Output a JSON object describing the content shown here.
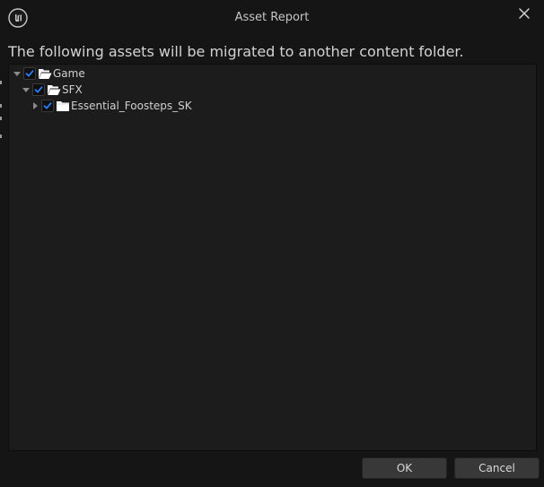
{
  "window": {
    "title": "Asset Report",
    "message": "The following assets will be migrated to another content folder."
  },
  "tree": {
    "nodes": [
      {
        "label": "Game",
        "checked": true,
        "expanded": true,
        "icon": "folder-open-icon"
      },
      {
        "label": "SFX",
        "checked": true,
        "expanded": true,
        "icon": "folder-open-icon"
      },
      {
        "label": "Essential_Foosteps_SK",
        "checked": true,
        "expanded": false,
        "icon": "folder-closed-icon"
      }
    ]
  },
  "buttons": {
    "ok_label": "OK",
    "cancel_label": "Cancel"
  },
  "colors": {
    "background": "#151515",
    "panel": "#1c1c1c",
    "check_accent": "#2a7fff",
    "button": "#383838"
  }
}
